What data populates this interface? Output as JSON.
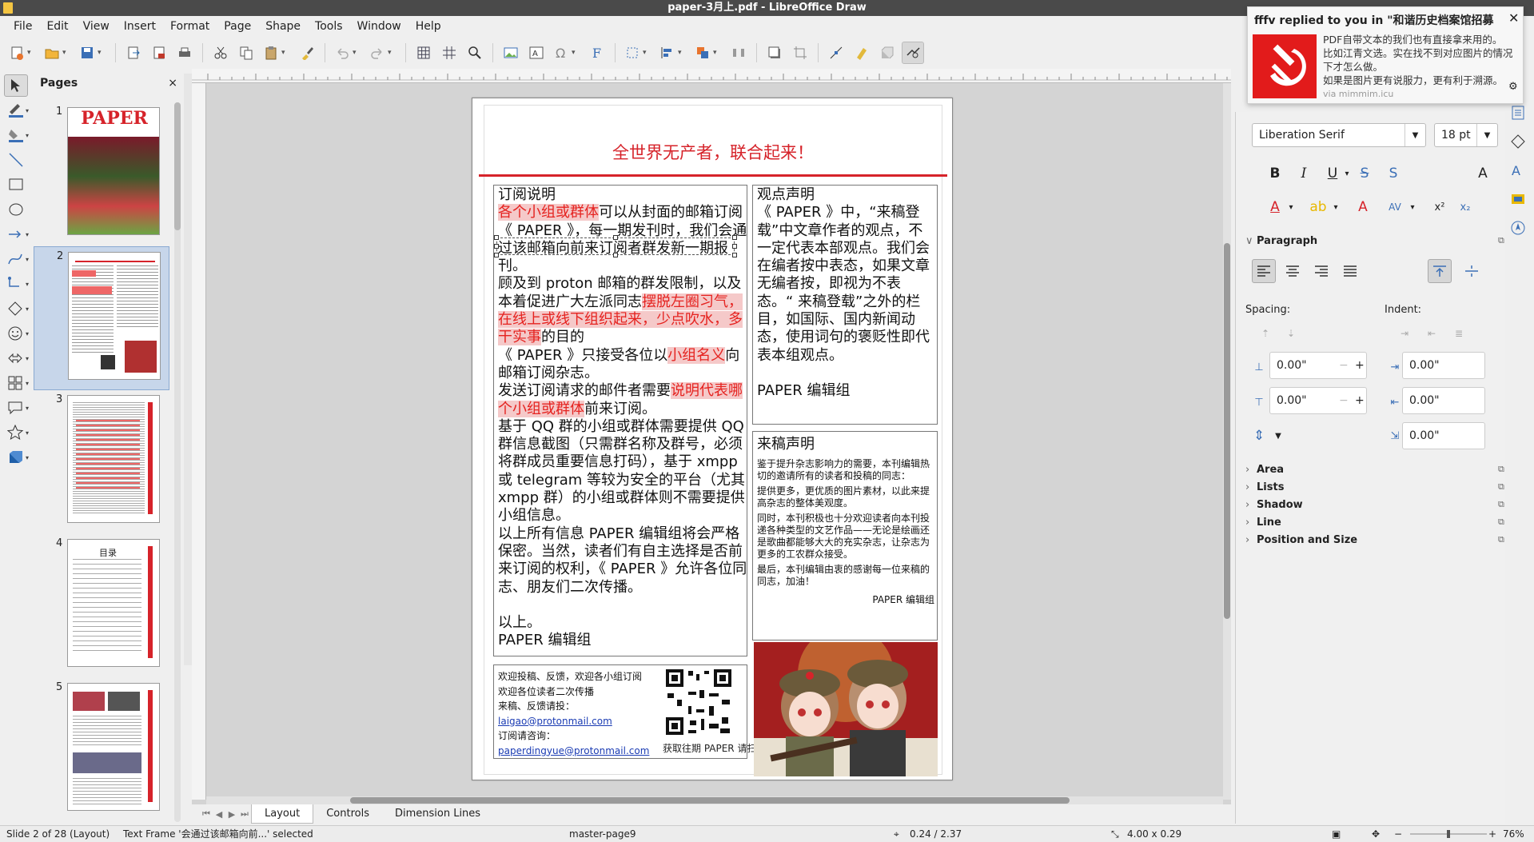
{
  "window": {
    "title": "paper-3月上.pdf - LibreOffice Draw"
  },
  "menu": [
    "File",
    "Edit",
    "View",
    "Insert",
    "Format",
    "Page",
    "Shape",
    "Tools",
    "Window",
    "Help"
  ],
  "pages_panel": {
    "title": "Pages",
    "close": "×",
    "thumbnails": [
      {
        "num": "1",
        "label": "PAPER"
      },
      {
        "num": "2",
        "label": ""
      },
      {
        "num": "3",
        "label": ""
      },
      {
        "num": "4",
        "label": "目录"
      },
      {
        "num": "5",
        "label": ""
      }
    ]
  },
  "document": {
    "slogan": "全世界无产者，联合起来！",
    "subscription": {
      "heading": "订阅说明",
      "p1_red": "各个小组或群体",
      "p1_rest": "可以从封面的邮箱订阅《 PAPER 》，每一期发刊时，我们会通过该邮箱向前来订阅者群发新一期报刊。",
      "p2_a": "顾及到 proton 邮箱的群发限制，以及本着促进广大左派同志",
      "p2_red": "摆脱左圈习气，在线上或线下组织起来，少点吹水，多干实事",
      "p2_b": "的目的",
      "p3_a": "《 PAPER 》只接受各位以",
      "p3_red": "小组名义",
      "p3_b": "向邮箱订阅杂志。",
      "p4_a": "发送订阅请求的邮件者需要",
      "p4_red": "说明代表哪个小组或群体",
      "p4_b": "前来订阅。",
      "p5": "基于 QQ 群的小组或群体需要提供 QQ 群信息截图（只需群名称及群号，必须将群成员重要信息打码），基于 xmpp 或 telegram 等较为安全的平台（尤其 xmpp 群）的小组或群体则不需要提供小组信息。",
      "p6": "以上所有信息 PAPER 编辑组将会严格保密。当然，读者们有自主选择是否前来订阅的权利，《 PAPER 》允许各位同志、朋友们二次传播。",
      "p7": "以上。",
      "sign": "PAPER  编辑组"
    },
    "viewpoint": {
      "heading": "观点声明",
      "body": "《 PAPER 》中，“来稿登载”中文章作者的观点，不一定代表本部观点。我们会在编者按中表态，如果文章无编者按，即视为不表态。“ 来稿登载”之外的栏目，如国际、国内新闻动态，使用词句的褒贬性即代表本组观点。",
      "sign": "PAPER  编辑组"
    },
    "contribution": {
      "heading": "来稿声明",
      "p1": "鉴于提升杂志影响力的需要，本刊编辑热切的邀请所有的读者和投稿的同志：",
      "p2": "提供更多，更优质的图片素材，以此来提高杂志的整体美观度。",
      "p3": "同时，本刊积极也十分欢迎读者向本刊投递各种类型的文艺作品——无论是绘画还是歌曲都能够大大的充实杂志，让杂志为更多的工农群众接受。",
      "p4": "最后，本刊编辑由衷的感谢每一位来稿的同志，加油！",
      "sign": "PAPER  编辑组"
    },
    "contact": {
      "l1": "欢迎投稿、反馈，欢迎各小组订阅",
      "l2": "欢迎各位读者二次传播",
      "l3": "来稿、反馈请投：",
      "email1": "laigao@protonmail.com",
      "l4": "订阅请咨询：",
      "email2": "paperdingyue@protonmail.com",
      "qr_caption": "获取往期 PAPER 请扫码"
    }
  },
  "bottom_tabs": [
    "Layout",
    "Controls",
    "Dimension Lines"
  ],
  "status": {
    "slide": "Slide 2 of 28 (Layout)",
    "selection": "Text Frame '会通过该邮箱向前...' selected",
    "master": "master-page9",
    "position": "0.24 / 2.37",
    "size": "4.00 x 0.29",
    "zoom": "76%"
  },
  "sidebar": {
    "font_name": "Liberation Serif",
    "font_size": "18 pt",
    "paragraph_label": "Paragraph",
    "spacing_label": "Spacing:",
    "indent_label": "Indent:",
    "above": "0.00\"",
    "below": "0.00\"",
    "indent_before": "0.00\"",
    "indent_after": "0.00\"",
    "first_line": "0.00\"",
    "sections": [
      "Area",
      "Lists",
      "Shadow",
      "Line",
      "Position and Size"
    ]
  },
  "notification": {
    "title": "fffv replied to you in \"和谐历史档案馆招募志...",
    "line1": "PDF自带文本的我们也有直接拿来用的。",
    "line2": "比如江青文选。实在找不到对应图片的情况下才怎么做。",
    "line3": "如果是图片更有说服力，更有利于溯源。",
    "via": "via mimmim.icu"
  },
  "colors": {
    "accent_red": "#d6232a",
    "selection_blue": "#c7d6ea"
  }
}
